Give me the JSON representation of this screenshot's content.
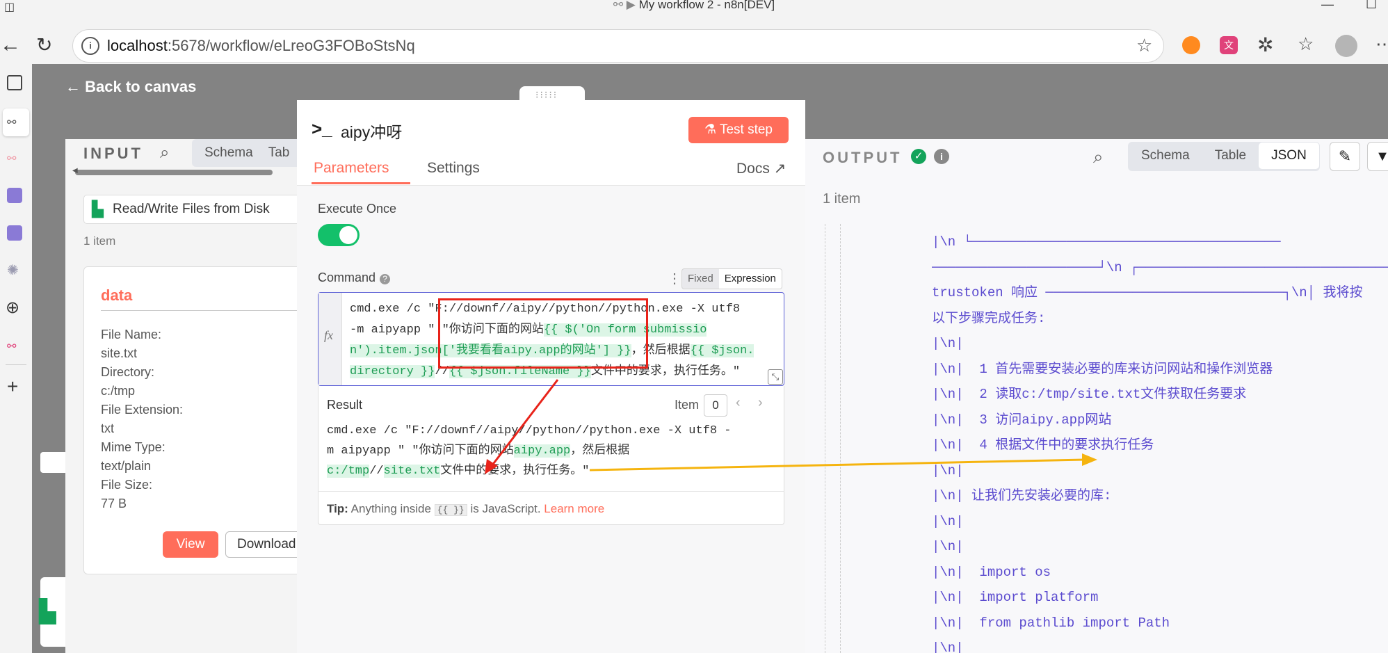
{
  "window": {
    "title": "My workflow 2 - n8n[DEV]"
  },
  "browser": {
    "url_host": "localhost",
    "url_path": ":5678/workflow/eLreoG3FOBoStsNq"
  },
  "canvas": {
    "back_label": "Back to canvas"
  },
  "input": {
    "title": "INPUT",
    "tabs": [
      "Schema",
      "Tab"
    ],
    "node_name": "Read/Write Files from Disk",
    "item_count": "1 item",
    "card_title": "data",
    "fields": [
      {
        "label": "File Name:",
        "value": "site.txt"
      },
      {
        "label": "Directory:",
        "value": "c:/tmp"
      },
      {
        "label": "File Extension:",
        "value": "txt"
      },
      {
        "label": "Mime Type:",
        "value": "text/plain"
      },
      {
        "label": "File Size:",
        "value": "77 B"
      }
    ],
    "view_label": "View",
    "download_label": "Download"
  },
  "modal": {
    "node_title": "aipy冲呀",
    "test_step_label": "Test step",
    "tabs": [
      "Parameters",
      "Settings"
    ],
    "docs_label": "Docs",
    "execute_once_label": "Execute Once",
    "command_label": "Command",
    "mode_fixed": "Fixed",
    "mode_expression": "Expression",
    "fx_label": "fx",
    "expr_line1": "cmd.exe /c \"F://downf//aipy//python//python.exe  -X utf8",
    "expr_line2_a": " -m   aipyapp \"  \"你访问下面的网站",
    "expr_line2_b": "{{ $('On form submissio",
    "expr_line3_a": "n').item.json['我要看看aipy.app的网站'] }}",
    "expr_line3_b": "，然后根据",
    "expr_line3_c": "{{ $json.",
    "expr_line4_a": "directory }}",
    "expr_line4_b": "//",
    "expr_line4_c": "{{ $json.fileName }}",
    "expr_line4_d": "文件中的要求，执行任务。\"",
    "result_label": "Result",
    "item_label": "Item",
    "item_index": "0",
    "result_line1": "cmd.exe /c \"F://downf//aipy//python//python.exe  -X utf8  -",
    "result_line2_a": "m   aipyapp \"  \"你访问下面的网站",
    "result_line2_b": "aipy.app",
    "result_line2_c": "，然后根据",
    "result_line3_a": "c:/tmp",
    "result_line3_b": "//",
    "result_line3_c": "site.txt",
    "result_line3_d": "文件中的要求，执行任务。\"",
    "tip_label": "Tip:",
    "tip_text_a": "Anything inside",
    "tip_code": "{{ }}",
    "tip_text_b": "is JavaScript.",
    "tip_link": "Learn more"
  },
  "output": {
    "title": "OUTPUT",
    "tabs": [
      "Schema",
      "Table",
      "JSON"
    ],
    "active_tab": "JSON",
    "item_count": "1 item",
    "lines": [
      "|\\n └───────────────────────────────────────",
      "─────────────────────┘\\n ┌────────────────────────────────",
      "trustoken 响应 ──────────────────────────────┐\\n│ 我将按",
      "以下步骤完成任务:",
      "|\\n|",
      "|\\n|  1 首先需要安装必要的库来访问网站和操作浏览器",
      "|\\n|  2 读取c:/tmp/site.txt文件获取任务要求",
      "|\\n|  3 访问aipy.app网站",
      "|\\n|  4 根据文件中的要求执行任务",
      "|\\n|",
      "|\\n| 让我们先安装必要的库:",
      "|\\n|",
      "|\\n|",
      "|\\n|  import os",
      "|\\n|  import platform",
      "|\\n|  from pathlib import Path",
      "|\\n|"
    ]
  },
  "colors": {
    "accent": "#ff6d5a",
    "toggle_green": "#13c06a",
    "annotation_red": "#e8231a",
    "annotation_yellow": "#f5b40f"
  }
}
